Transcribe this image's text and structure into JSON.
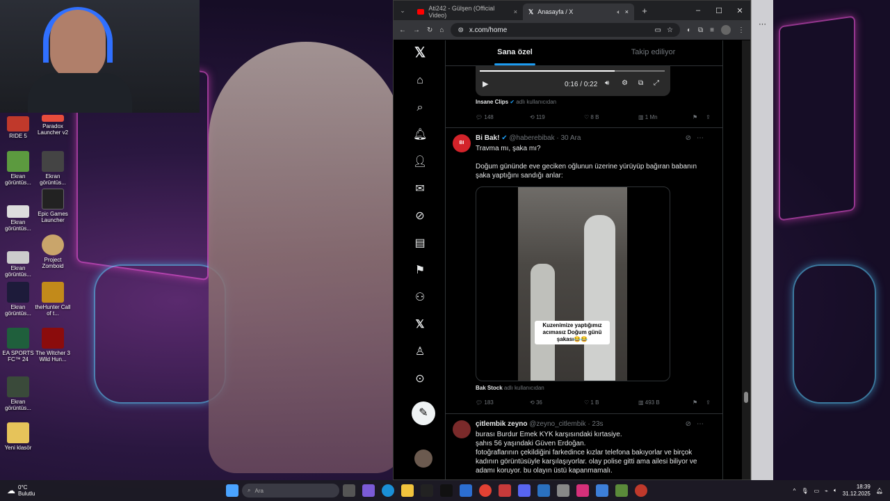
{
  "desktop": {
    "icons": [
      {
        "label": "RIDE 5",
        "color": "#c0392b"
      },
      {
        "label": "Paradox Launcher v2",
        "color": "#e74c3c"
      },
      {
        "label": "Ekran görüntüs...",
        "color": "#5c9a3f"
      },
      {
        "label": "Ekran görüntüs...",
        "color": "#444"
      },
      {
        "label": "Ekran görüntüs...",
        "color": "#ddd"
      },
      {
        "label": "Epic Games Launcher",
        "color": "#222"
      },
      {
        "label": "Ekran görüntüs...",
        "color": "#ccc"
      },
      {
        "label": "Project Zomboid",
        "color": "#c9a56b"
      },
      {
        "label": "Ekran görüntüs...",
        "color": "#1d1b3a"
      },
      {
        "label": "theHunter Call of t...",
        "color": "#c28a1a"
      },
      {
        "label": "EA SPORTS FC™ 24",
        "color": "#1f5f3c"
      },
      {
        "label": "The Witcher 3 Wild Hun...",
        "color": "#8b0c0c"
      },
      {
        "label": "Ekran görüntüs...",
        "color": "#3a4a3a"
      },
      {
        "label": "Yeni klasör",
        "color": "#e6c35a"
      }
    ]
  },
  "browser": {
    "tabs": [
      {
        "title": "Ati242 - Gülşen (Official Video)",
        "close": "×"
      },
      {
        "title": "Anasayfa / X",
        "close": "×"
      }
    ],
    "new_tab": "+",
    "url": "x.com/home",
    "win": {
      "min": "–",
      "max": "☐",
      "close": "✕"
    }
  },
  "x": {
    "tabs": {
      "for_you": "Sana özel",
      "following": "Takip ediliyor"
    },
    "video": {
      "time": "0:16 / 0:22"
    },
    "post1": {
      "source_name": "Insane Clips",
      "source_suffix": "adlı kullanıcıdan",
      "replies": "148",
      "reposts": "119",
      "likes": "8 B",
      "views": "1 Mn"
    },
    "post2": {
      "name": "Bi Bak!",
      "handle": "@haberebibak · 30 Ara",
      "text1": "Travma mı, şaka mı?",
      "text2": "Doğum gününde eve geciken oğlunun üzerine yürüyüp bağıran babanın şaka yaptığını sandığı anlar:",
      "caption": "Kuzenimize yaptığımız acımasız Doğum günü şakası😂😂",
      "source_name": "Bak Stock",
      "source_suffix": "adlı kullanıcıdan",
      "replies": "183",
      "reposts": "36",
      "likes": "1 B",
      "views": "493 B"
    },
    "post3": {
      "name": "çitlembik zeyno",
      "handle": "@zeyno_citlembik · 23s",
      "lines": [
        "burası Burdur Emek KYK karşısındaki kırtasiye.",
        "şahıs 56 yaşındaki Güven Erdoğan.",
        "fotoğraflarının çekildiğini farkedince kızlar telefona bakıyorlar ve birçok",
        "kadının görüntüsüyle karşılaşıyorlar. olay polise gitti ama ailesi biliyor ve",
        "adamı koruyor. bu olayın üstü kapanmamalı."
      ]
    }
  },
  "taskbar": {
    "weather_temp": "0°C",
    "weather_text": "Bulutlu",
    "search_placeholder": "Ara",
    "time": "18:39",
    "date": "31.12.2025"
  },
  "colors": {
    "accent": "#1d9bf0",
    "x_bg": "#000000"
  }
}
